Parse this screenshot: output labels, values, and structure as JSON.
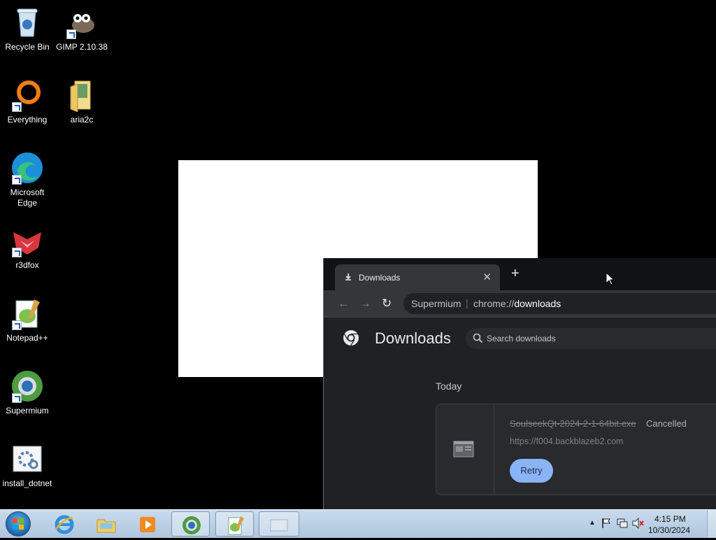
{
  "desktop": {
    "icons": [
      {
        "label": "Recycle Bin"
      },
      {
        "label": "GIMP 2.10.38"
      },
      {
        "label": "Everything"
      },
      {
        "label": "aria2c"
      },
      {
        "label": "Microsoft Edge"
      },
      {
        "label": "r3dfox"
      },
      {
        "label": "Notepad++"
      },
      {
        "label": "Supermium"
      },
      {
        "label": "install_dotnet"
      }
    ]
  },
  "browser": {
    "tab_title": "Downloads",
    "omnibox_site": "Supermium",
    "omnibox_scheme": "chrome://",
    "omnibox_path": "downloads",
    "page_title": "Downloads",
    "search_placeholder": "Search downloads",
    "day_label": "Today",
    "download": {
      "file_name": "SoulseekQt-2024-2-1-64bit.exe",
      "status": "Cancelled",
      "url": "https://f004.backblazeb2.com",
      "retry_label": "Retry"
    }
  },
  "taskbar": {
    "time": "4:15 PM",
    "date": "10/30/2024"
  },
  "colors": {
    "accent_button": "#8ab4f8",
    "page_bg": "#202124"
  }
}
